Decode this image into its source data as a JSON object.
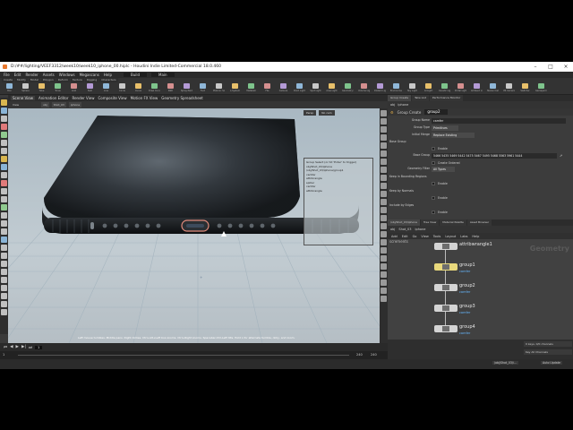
{
  "window": {
    "title": "D:/##/lighting/VEEF3312/week10/week10_iphone_00.hiplc - Houdini Indie Limited-Commercial 18.0.460"
  },
  "menubar": [
    "File",
    "Edit",
    "Render",
    "Assets",
    "Windows",
    "Megascans",
    "Help",
    "Build",
    "Main"
  ],
  "shelf": {
    "tabs": [
      "Create",
      "Modify",
      "Model",
      "Polygon",
      "Deform",
      "Texture",
      "Rigging",
      "Characters",
      "Constraints",
      "Hair Utils",
      "Guide Pr.",
      "Terrain FX",
      "Simple FX",
      "Cloud FX",
      "Volume",
      "Lights and Cam.",
      "Collisions",
      "Particles",
      "Grains",
      "Vellum",
      "Rigid Bodies",
      "Particle Fluids",
      "Viscous Fluids",
      "Oceans",
      "Fluid Containers",
      "Populate Containers",
      "Container Tools",
      "Pyro FX",
      "FEM",
      "Wires",
      "Crowds",
      "Drive Simulation"
    ],
    "tools": [
      "Box",
      "Sphere",
      "Tube",
      "Torus",
      "Grid",
      "Null",
      "Line",
      "Circle",
      "Curve",
      "Draw Curve",
      "Path",
      "Spray Paint",
      "Font",
      "Platonic Solids",
      "L-System",
      "Metaball",
      "File",
      "Camera",
      "Point Light",
      "Spot Light",
      "Area Light",
      "Geometry Light",
      "Volume Light",
      "Distant Light",
      "Environment Light",
      "Sky Light",
      "GI Light",
      "Caustic Light",
      "Portal Light",
      "Ambient Light",
      "Stereo Camera",
      "VR Camera",
      "Switcher",
      "Gamepad Camera"
    ]
  },
  "viewport": {
    "pane_tabs": [
      "Scene View",
      "Animation Editor",
      "Render View",
      "Composite View",
      "Motion FX View",
      "Geometry Spreadsheet"
    ],
    "header_label": "View",
    "path": [
      "obj",
      "Shot_03",
      "iphone"
    ],
    "toolbar_buttons": [
      "Persp",
      "No cam"
    ],
    "status_message": "Left mouse tumbles. Middle pans. Right dollies. Ctrl+Alt+Left box-zooms. Ctrl+Right zooms. Spacebar-Ctrl-Left tilts. Hold L for alternate tumble, dolly, and zoom.",
    "tooltip_lines": [
      "Group Select (or hit 'Enter' to trigger)",
      "obj/Shot_03/iphone",
      "/obj/Shot_03/iphone/group1",
      "camfer",
      "attribrangle",
      "spiller",
      "camfer",
      "attribrangle"
    ]
  },
  "playbar": {
    "start": "1",
    "current_frame": "1",
    "end": "240",
    "end2": "240",
    "keys_label": "0 keys, 0/0 channels",
    "channels_label": "Key All Channels"
  },
  "parameters": {
    "pane_tabs": [
      "Group Create",
      "Take List",
      "Performance Monitor"
    ],
    "path": [
      "obj",
      "iphone"
    ],
    "node_type": "Group Create",
    "node_name": "group2",
    "fields": [
      {
        "label": "Group Name",
        "value": "camfer"
      },
      {
        "label": "Group Type",
        "value": "Primitives"
      },
      {
        "label": "Initial Merge",
        "value": "Replace Existing"
      }
    ],
    "base_group_section": "Base Group",
    "enable_label": "Enable",
    "base_group_label": "Base Group",
    "base_group_value": "5466 5435 5469 5442 5475 5467 5495 5468 5563 5961 5444",
    "create_ordered_label": "Create Ordered",
    "geometry_filter_label": "Geometry Filter",
    "geometry_filter_value": "All Types",
    "keep_bounding_section": "Keep in Bounding Regions",
    "keep_normals_section": "Keep by Normals",
    "include_edges_section": "Include by Edges",
    "enable2": "Enable",
    "enable3": "Enable",
    "enable4": "Enable"
  },
  "network": {
    "pane_tabs": [
      "/obj/Shot_03/iphone",
      "Tree View",
      "Material Palette",
      "Asset Browser"
    ],
    "path": [
      "obj",
      "Shot_03",
      "iphone"
    ],
    "menu": [
      "Add",
      "Edit",
      "Go",
      "View",
      "Tools",
      "Layout",
      "Labs",
      "Help"
    ],
    "context_label": "Geometry",
    "left_label": "screments",
    "nodes": [
      {
        "name": "attribwrangle1",
        "sub": "",
        "selected": false
      },
      {
        "name": "group1",
        "sub": "camfer",
        "selected": true
      },
      {
        "name": "group2",
        "sub": "camfer",
        "selected": false
      },
      {
        "name": "group3",
        "sub": "camfer",
        "selected": false
      },
      {
        "name": "group4",
        "sub": "camfer",
        "selected": false
      }
    ]
  },
  "status": {
    "right_path": "/obj/Shot_03/i...",
    "auto_update": "Auto Update"
  },
  "colors": {
    "viewport_sky": "#b4c0c8",
    "node_default": "#d4d4d4",
    "node_selected": "#e9d97c",
    "group_sub": "#66b8ff",
    "usb_port_accent": "#e08a7b"
  }
}
